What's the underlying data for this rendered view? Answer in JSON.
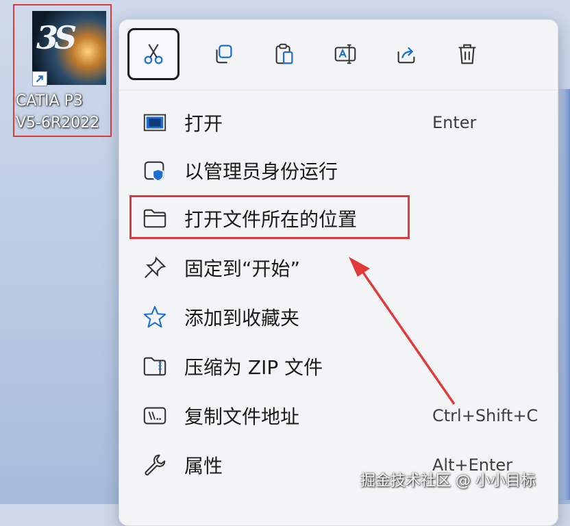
{
  "desktop": {
    "icon_name": "catia-icon",
    "label_line1": "CATIA P3",
    "label_line2": "V5-6R2022",
    "logo_text": "3S"
  },
  "toolbar": {
    "cut_icon": "scissors-icon",
    "copy_icon": "copy-icon",
    "paste_icon": "paste-icon",
    "rename_icon": "rename-icon",
    "share_icon": "share-icon",
    "delete_icon": "trash-icon"
  },
  "menu": {
    "items": [
      {
        "label": "打开",
        "shortcut": "Enter",
        "icon": "window-icon"
      },
      {
        "label": "以管理员身份运行",
        "shortcut": "",
        "icon": "shield-icon"
      },
      {
        "label": "打开文件所在的位置",
        "shortcut": "",
        "icon": "folder-icon"
      },
      {
        "label": "固定到“开始”",
        "shortcut": "",
        "icon": "pin-icon"
      },
      {
        "label": "添加到收藏夹",
        "shortcut": "",
        "icon": "star-icon"
      },
      {
        "label": "压缩为 ZIP 文件",
        "shortcut": "",
        "icon": "zip-folder-icon"
      },
      {
        "label": "复制文件地址",
        "shortcut": "Ctrl+Shift+C",
        "icon": "path-icon"
      },
      {
        "label": "属性",
        "shortcut": "Alt+Enter",
        "icon": "wrench-icon"
      }
    ]
  },
  "watermark": "掘金技术社区 @ 小小目标",
  "colors": {
    "highlight": "#de3838",
    "menu_bg": "#f3f4f6",
    "accent": "#1f6fd0"
  }
}
